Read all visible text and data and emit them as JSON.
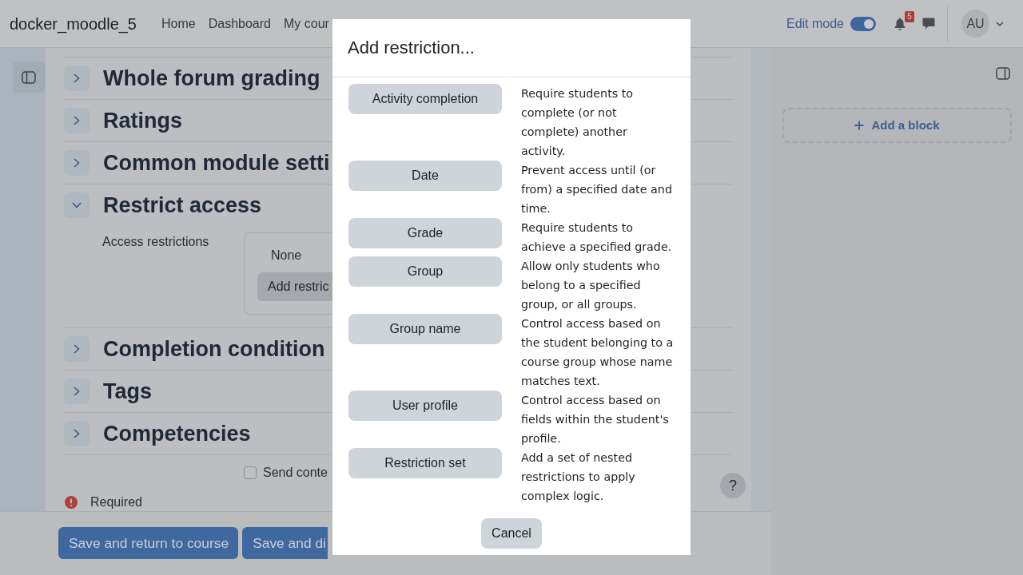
{
  "navbar": {
    "site_name": "docker_moodle_5",
    "links": [
      "Home",
      "Dashboard",
      "My cour"
    ],
    "edit_mode": {
      "label": "Edit mode",
      "on": true
    },
    "notifications": {
      "badge": "5"
    },
    "user": {
      "initials": "AU"
    }
  },
  "sections": [
    {
      "title": "Whole forum grading",
      "expanded": false
    },
    {
      "title": "Ratings",
      "expanded": false
    },
    {
      "title": "Common module setti",
      "expanded": false
    },
    {
      "title": "Restrict access",
      "expanded": true,
      "content": {
        "label": "Access restrictions",
        "value": "None",
        "button": "Add restric"
      }
    },
    {
      "title": "Completion condition",
      "expanded": false
    },
    {
      "title": "Tags",
      "expanded": false
    },
    {
      "title": "Competencies",
      "expanded": false
    }
  ],
  "send_content": {
    "label": "Send conte",
    "checked": false
  },
  "required_note": "Required",
  "help_button": "?",
  "footer": {
    "buttons": [
      "Save and return to course",
      "Save and di"
    ]
  },
  "block_drawer": {
    "add_block": "Add a block"
  },
  "modal": {
    "title": "Add restriction...",
    "options": [
      {
        "label": "Activity completion",
        "description": "Require students to complete (or not complete) another activity."
      },
      {
        "label": "Date",
        "description": "Prevent access until (or from) a specified date and time."
      },
      {
        "label": "Grade",
        "description": "Require students to achieve a specified grade."
      },
      {
        "label": "Group",
        "description": "Allow only students who belong to a specified group, or all groups."
      },
      {
        "label": "Group name",
        "description": "Control access based on the student belonging to a course group whose name matches text."
      },
      {
        "label": "User profile",
        "description": "Control access based on fields within the student's profile."
      },
      {
        "label": "Restriction set",
        "description": "Add a set of nested restrictions to apply complex logic."
      }
    ],
    "cancel": "Cancel"
  }
}
